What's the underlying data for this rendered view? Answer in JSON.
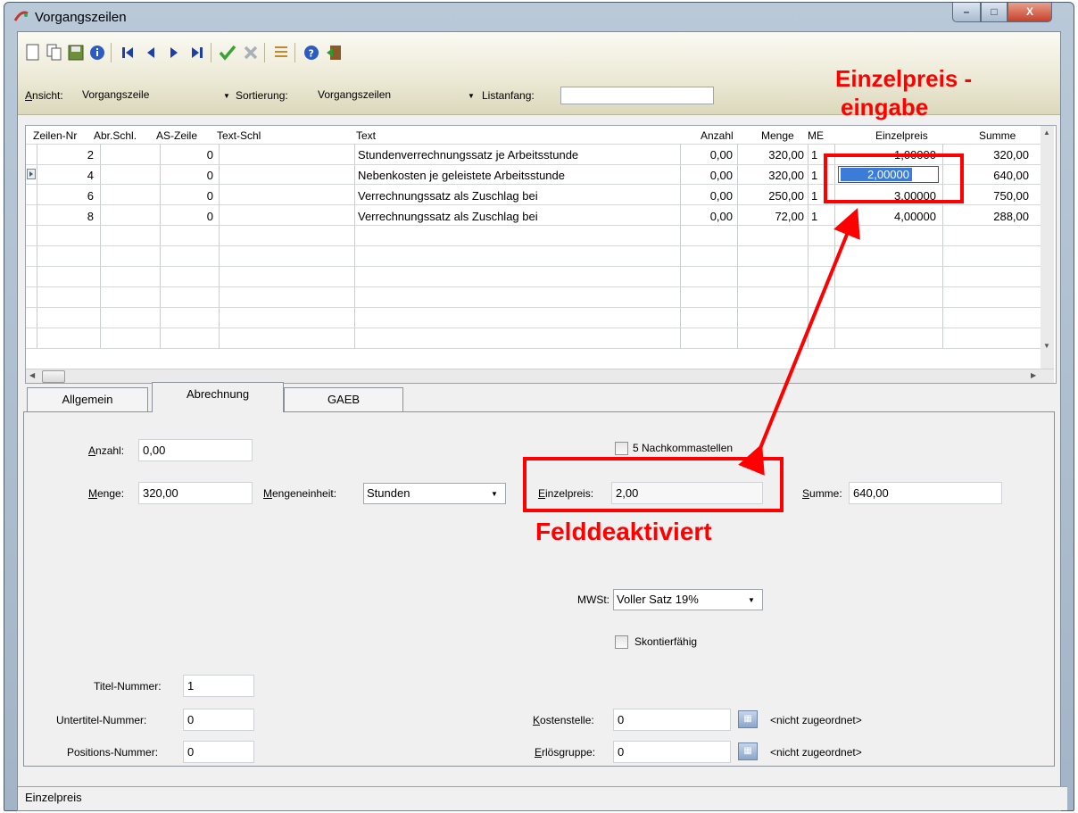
{
  "window": {
    "title": "Vorgangszeilen",
    "min_glyph": "–",
    "max_glyph": "□",
    "close_glyph": "X"
  },
  "toolbar": {
    "icons": [
      "new-document-icon",
      "copy-icon",
      "save-icon",
      "info-icon",
      "first-record-icon",
      "previous-record-icon",
      "next-record-icon",
      "last-record-icon",
      "confirm-icon",
      "cancel-icon",
      "list-icon",
      "help-icon",
      "exit-icon"
    ],
    "ansicht_label": "Ansicht:",
    "ansicht_value": "Vorgangszeile",
    "sortierung_label": "Sortierung:",
    "sortierung_value": "Vorgangszeilen",
    "listanfang_label": "Listanfang:",
    "listanfang_value": ""
  },
  "grid": {
    "columns": [
      "Zeilen-Nr",
      "Abr.Schl.",
      "AS-Zeile",
      "Text-Schl",
      "Text",
      "Anzahl",
      "Menge",
      "ME",
      "Einzelpreis",
      "Summe"
    ],
    "rows": [
      {
        "zeilen_nr": "2",
        "as_zeile": "0",
        "text": "Stundenverrechnungssatz je Arbeitsstunde",
        "anzahl": "0,00",
        "menge": "320,00",
        "me": "1",
        "einzelpreis": "1,00000",
        "summe": "320,00"
      },
      {
        "zeilen_nr": "4",
        "as_zeile": "0",
        "text": "Nebenkosten je geleistete Arbeitsstunde",
        "anzahl": "0,00",
        "menge": "320,00",
        "me": "1",
        "einzelpreis": "2,00000",
        "summe": "640,00"
      },
      {
        "zeilen_nr": "6",
        "as_zeile": "0",
        "text": "Verrechnungssatz als Zuschlag bei",
        "anzahl": "0,00",
        "menge": "250,00",
        "me": "1",
        "einzelpreis": "3,00000",
        "summe": "750,00"
      },
      {
        "zeilen_nr": "8",
        "as_zeile": "0",
        "text": "Verrechnungssatz als Zuschlag bei",
        "anzahl": "0,00",
        "menge": "72,00",
        "me": "1",
        "einzelpreis": "4,00000",
        "summe": "288,00"
      }
    ]
  },
  "tabs": [
    "Allgemein",
    "Abrechnung",
    "GAEB"
  ],
  "form": {
    "anzahl_label": "Anzahl:",
    "anzahl_value": "0,00",
    "menge_label": "Menge:",
    "menge_value": "320,00",
    "mengeneinheit_label": "Mengeneinheit:",
    "mengeneinheit_value": "Stunden",
    "nachkommastellen_label": "5 Nachkommastellen",
    "einzelpreis_label": "Einzelpreis:",
    "einzelpreis_value": "2,00",
    "summe_label": "Summe:",
    "summe_value": "640,00",
    "mwst_label": "MWSt:",
    "mwst_value": "Voller Satz 19%",
    "skontierfaehig_label": "Skontierfähig",
    "titel_nummer_label": "Titel-Nummer:",
    "titel_nummer_value": "1",
    "untertitel_nummer_label": "Untertitel-Nummer:",
    "untertitel_nummer_value": "0",
    "positions_nummer_label": "Positions-Nummer:",
    "positions_nummer_value": "0",
    "kostenstelle_label": "Kostenstelle:",
    "kostenstelle_value": "0",
    "kostenstelle_info": "<nicht zugeordnet>",
    "erloesgruppe_label": "Erlösgruppe:",
    "erloesgruppe_value": "0",
    "erloesgruppe_info": "<nicht zugeordnet>"
  },
  "statusbar": {
    "text": "Einzelpreis"
  },
  "annotations": {
    "top_line1": "Einzelpreis -",
    "top_line2": "eingabe",
    "middle": "Felddeaktiviert",
    "color": "#ff0000"
  }
}
